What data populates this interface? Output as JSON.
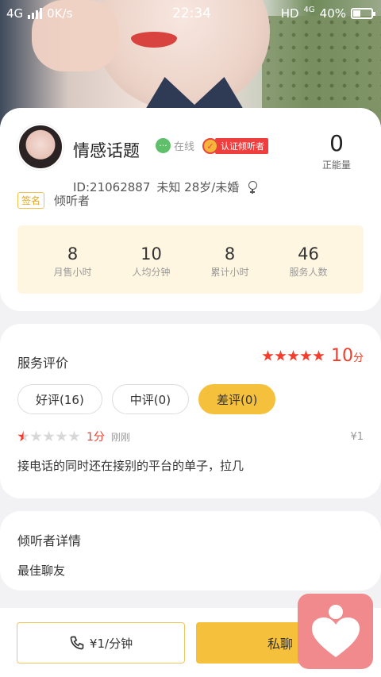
{
  "status_bar": {
    "network": "4G",
    "speed": "0K/s",
    "time": "22:34",
    "hd": "HD",
    "net4g": "4G",
    "battery": "40%",
    "battery_level": 0.4
  },
  "profile": {
    "name": "情感话题",
    "online_label": "在线",
    "verified_label": "认证倾听者",
    "energy_value": "0",
    "energy_label": "正能量",
    "id": "ID:21062887",
    "info": "未知 28岁/未婚",
    "sign_tag": "签名",
    "sign_value": "倾听者"
  },
  "stats": [
    {
      "value": "8",
      "label": "月售小时"
    },
    {
      "value": "10",
      "label": "人均分钟"
    },
    {
      "value": "8",
      "label": "累计小时"
    },
    {
      "value": "46",
      "label": "服务人数"
    }
  ],
  "reviews": {
    "title": "服务评价",
    "score": "10",
    "score_unit": "分",
    "stars": 5,
    "filters": [
      {
        "label": "好评(16)",
        "active": false
      },
      {
        "label": "中评(0)",
        "active": false
      },
      {
        "label": "差评(0)",
        "active": true
      }
    ],
    "item": {
      "stars": 0.5,
      "points": "1分",
      "time": "刚刚",
      "price": "¥1",
      "text": "接电话的同时还在接别的平台的单子，拉几"
    }
  },
  "detail": {
    "title": "倾听者详情",
    "value": "最佳聊友"
  },
  "bottom": {
    "call_label": "¥1/分钟",
    "chat_label": "私聊"
  },
  "colors": {
    "accent": "#f5c13c",
    "red": "#f23c2c",
    "fab": "#f08a8c"
  }
}
